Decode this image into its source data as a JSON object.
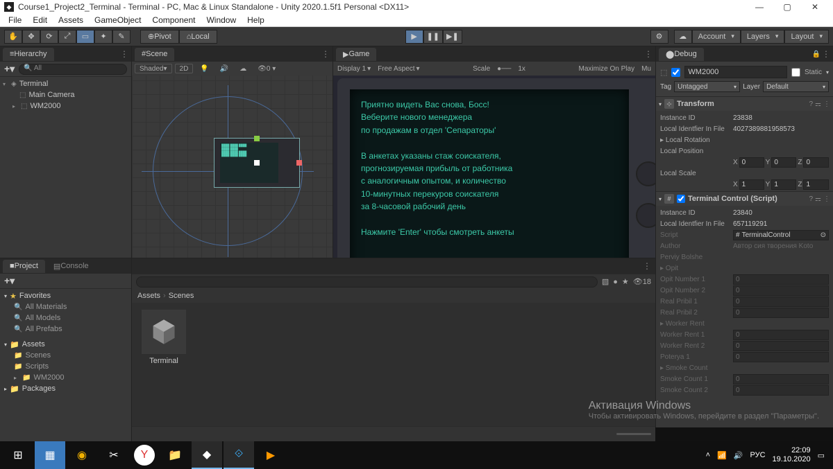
{
  "window": {
    "title": "Course1_Project2_Terminal - Terminal - PC, Mac & Linux Standalone - Unity 2020.1.5f1 Personal <DX11>"
  },
  "menu": [
    "File",
    "Edit",
    "Assets",
    "GameObject",
    "Component",
    "Window",
    "Help"
  ],
  "toolbar": {
    "pivot": "Pivot",
    "local": "Local",
    "account": "Account",
    "layers": "Layers",
    "layout": "Layout"
  },
  "hierarchy": {
    "tab": "Hierarchy",
    "search_ph": "All",
    "scene": "Terminal",
    "items": [
      "Main Camera",
      "WM2000"
    ]
  },
  "scene": {
    "tab": "Scene",
    "shading": "Shaded",
    "mode2d": "2D"
  },
  "game": {
    "tab": "Game",
    "display": "Display 1",
    "aspect": "Free Aspect",
    "scale_label": "Scale",
    "scale_value": "1x",
    "maximize": "Maximize On Play",
    "mute": "Mu",
    "terminal_text": "Приятно видеть Вас снова, Босс!\nВеберите нового менеджера\nпо продажам в отдел 'Сепараторы'\n\nВ анкетах указаны стаж соискателя,\nпрогнозируемая прибыль от работника\nс аналогичным опытом, и количество\n10-минутных перекуров соискателя\nза 8-часовой рабочий день\n\nНажмите 'Enter' чтобы смотреть анкеты\n\n_"
  },
  "project": {
    "tab_project": "Project",
    "tab_console": "Console",
    "fav_label": "Favorites",
    "fav_items": [
      "All Materials",
      "All Models",
      "All Prefabs"
    ],
    "assets_label": "Assets",
    "folders": [
      "Scenes",
      "Scripts",
      "WM2000"
    ],
    "packages_label": "Packages",
    "breadcrumb": [
      "Assets",
      "Scenes"
    ],
    "asset_name": "Terminal",
    "hidden_count": "18"
  },
  "inspector": {
    "tab": "Debug",
    "object_name": "WM2000",
    "static_label": "Static",
    "tag_label": "Tag",
    "tag_value": "Untagged",
    "layer_label": "Layer",
    "layer_value": "Default",
    "transform": {
      "title": "Transform",
      "instance_id_label": "Instance ID",
      "instance_id": "23838",
      "localfile_label": "Local Identfier In File",
      "localfile": "4027389881958573",
      "rotation_label": "Local Rotation",
      "position_label": "Local Position",
      "pos": {
        "x": "0",
        "y": "0",
        "z": "0"
      },
      "scale_label": "Local Scale",
      "scale": {
        "x": "1",
        "y": "1",
        "z": "1"
      }
    },
    "script": {
      "title": "Terminal Control (Script)",
      "instance_id_label": "Instance ID",
      "instance_id": "23840",
      "localfile_label": "Local Identfier In File",
      "localfile": "657119291",
      "script_label": "Script",
      "script_value": "TerminalControl",
      "fields": [
        {
          "label": "Author",
          "value": "Автор сия творения Koto",
          "dim": true
        },
        {
          "label": "Perviy Bolshe",
          "value": "",
          "dim": true
        },
        {
          "label": "Opit",
          "value": "",
          "dim": true,
          "arr": true
        },
        {
          "label": "Opit Number 1",
          "value": "0",
          "dim": true
        },
        {
          "label": "Opit Number 2",
          "value": "0",
          "dim": true
        },
        {
          "label": "Real Pribil 1",
          "value": "0",
          "dim": true
        },
        {
          "label": "Real Pribil 2",
          "value": "0",
          "dim": true
        },
        {
          "label": "Worker Rent",
          "value": "",
          "dim": true,
          "arr": true
        },
        {
          "label": "Worker Rent 1",
          "value": "0",
          "dim": true
        },
        {
          "label": "Worker Rent 2",
          "value": "0",
          "dim": true
        },
        {
          "label": "Poterya 1",
          "value": "0",
          "dim": true
        },
        {
          "label": "Smoke Count",
          "value": "",
          "dim": true,
          "arr": true
        },
        {
          "label": "Smoke Count 1",
          "value": "0",
          "dim": true
        },
        {
          "label": "Smoke Count 2",
          "value": "0",
          "dim": true
        }
      ]
    }
  },
  "watermark": {
    "title": "Активация Windows",
    "sub": "Чтобы активировать Windows, перейдите в раздел \"Параметры\"."
  },
  "taskbar": {
    "lang": "РУС",
    "time": "22:09",
    "date": "19.10.2020"
  }
}
